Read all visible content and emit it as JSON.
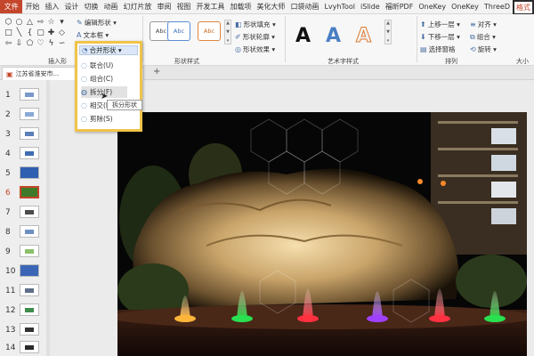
{
  "tabs": [
    {
      "label": "开始"
    },
    {
      "label": "插入"
    },
    {
      "label": "设计"
    },
    {
      "label": "切换"
    },
    {
      "label": "动画"
    },
    {
      "label": "幻灯片放"
    },
    {
      "label": "审阅"
    },
    {
      "label": "视图"
    },
    {
      "label": "开发工具"
    },
    {
      "label": "加载项"
    },
    {
      "label": "美化大师"
    },
    {
      "label": "口袋动画"
    },
    {
      "label": "LvyhTool"
    },
    {
      "label": "iSlide"
    },
    {
      "label": "福昕PDF"
    },
    {
      "label": "OneKey"
    },
    {
      "label": "OneKey"
    },
    {
      "label": "ThreeD"
    }
  ],
  "file_tab": "文件",
  "active_tab": "格式",
  "ribbon": {
    "edit_shape": "编辑形状 ▾",
    "text_box": "文本框 ▾",
    "merge_shapes": "合并形状 ▾",
    "insert_group_label": "插入形",
    "shape_styles_label": "形状样式",
    "style_sample": "Abc",
    "shape_fill": "形状填充 ▾",
    "shape_outline": "形状轮廓 ▾",
    "shape_effects": "形状效果 ▾",
    "art_text_label": "艺术字样式",
    "art_letter": "A",
    "bring_forward": "上移一层 ▾",
    "send_backward": "下移一层 ▾",
    "selection_pane": "选择窗格",
    "align": "对齐 ▾",
    "group": "组合 ▾",
    "rotate": "旋转 ▾",
    "arrange_label": "排列",
    "size_label": "大小"
  },
  "dropdown": {
    "items": [
      {
        "label": "联合(U)"
      },
      {
        "label": "组合(C)"
      },
      {
        "label": "拆分(F)"
      },
      {
        "label": "相交(I)"
      },
      {
        "label": "剪除(S)"
      }
    ],
    "tooltip": "拆分形状"
  },
  "document": {
    "tab_title": "江苏省淮安市...",
    "add_tab": "+"
  },
  "slides": {
    "numbers": [
      "1",
      "2",
      "3",
      "4",
      "5",
      "6",
      "7",
      "8",
      "9",
      "10",
      "11",
      "12",
      "13",
      "14"
    ],
    "selected_index": 6
  },
  "colors": {
    "accent": "#c4462b",
    "highlight_box": "#f0c34a"
  }
}
